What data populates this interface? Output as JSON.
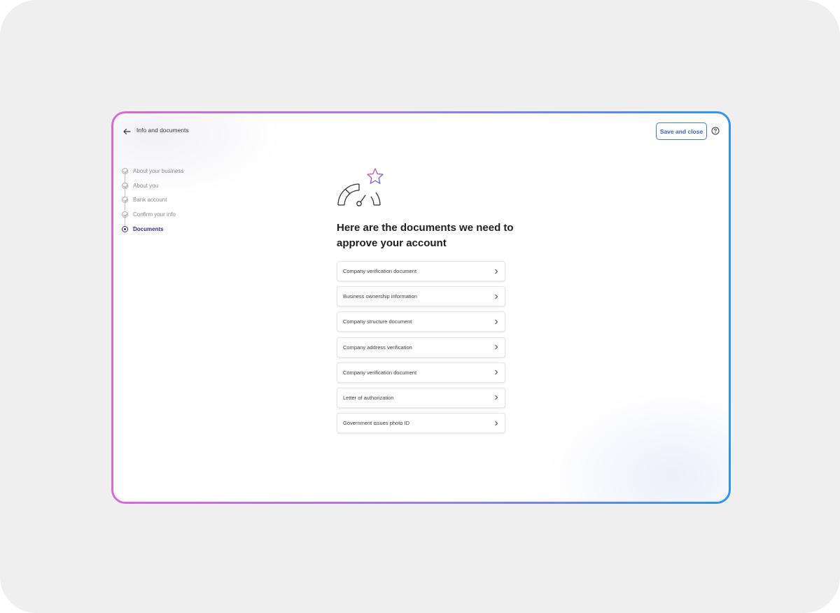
{
  "topbar": {
    "title": "Info and documents",
    "save_label": "Save and close"
  },
  "stepper": {
    "steps": [
      {
        "label": "About your business",
        "state": "done"
      },
      {
        "label": "About you",
        "state": "done"
      },
      {
        "label": "Bank account",
        "state": "done"
      },
      {
        "label": "Confirm your info",
        "state": "done"
      },
      {
        "label": "Documents",
        "state": "current"
      }
    ]
  },
  "main": {
    "heading": "Here are the documents we need to approve your account",
    "documents": [
      "Company verification document",
      "Business ownership information",
      "Company structure document",
      "Company address verification",
      "Company verification document",
      "Letter of authorization",
      "Government issues photo ID"
    ]
  },
  "colors": {
    "accent": "#2e2d8c",
    "button_border": "#4b78c8",
    "frame_gradient_start": "#d66ad6",
    "frame_gradient_end": "#2f95ea"
  },
  "icons": {
    "back": "arrow-left-icon",
    "help": "question-circle-icon",
    "chevron": "chevron-right-icon",
    "illustration": "gauge-star-illustration"
  }
}
